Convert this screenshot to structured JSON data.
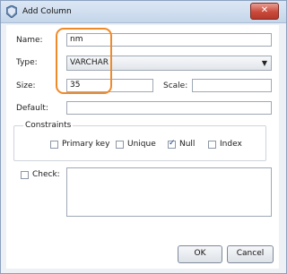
{
  "window": {
    "title": "Add Column",
    "close_label": "✕"
  },
  "form": {
    "name_label": "Name:",
    "name_value": "nm",
    "type_label": "Type:",
    "type_value": "VARCHAR",
    "size_label": "Size:",
    "size_value": "35",
    "scale_label": "Scale:",
    "scale_value": "",
    "default_label": "Default:",
    "default_value": ""
  },
  "constraints": {
    "title": "Constraints",
    "items": [
      {
        "label": "Primary key",
        "checked": false
      },
      {
        "label": "Unique",
        "checked": false
      },
      {
        "label": "Null",
        "checked": true
      },
      {
        "label": "Index",
        "checked": false
      }
    ]
  },
  "check": {
    "label": "Check:",
    "checked": false,
    "value": ""
  },
  "buttons": {
    "ok": "OK",
    "cancel": "Cancel"
  },
  "colors": {
    "highlight": "#ef8a2a",
    "close": "#c94a3b"
  },
  "icons": {
    "app": "db-shield-icon",
    "dropdown": "chevron-down-icon",
    "close": "close-icon"
  }
}
